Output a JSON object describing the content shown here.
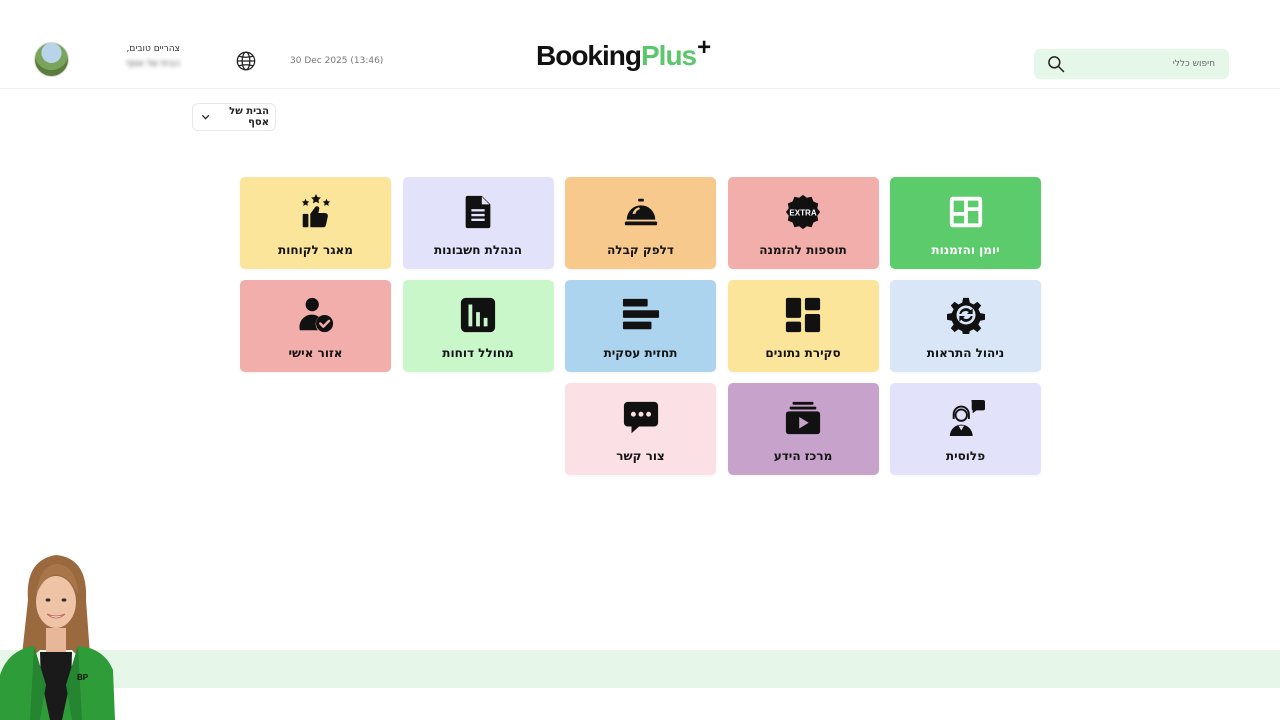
{
  "header": {
    "greeting": "צהריים טובים,",
    "business_name": "הבית של אסף",
    "datetime": "30 Dec 2025 (13:46)",
    "logo": {
      "part1": "Booking",
      "part2": "Plus",
      "plus": "+"
    },
    "search": {
      "placeholder": "חיפוש כללי"
    }
  },
  "business_selector": {
    "label": "הבית של אסף"
  },
  "tiles": [
    {
      "label": "יומן והזמנות",
      "icon": "calendar-grid-icon",
      "color": "#5ccb6c"
    },
    {
      "label": "תוספות להזמנה",
      "icon": "extra-badge-icon",
      "color": "#f2aeaa"
    },
    {
      "label": "דלפק קבלה",
      "icon": "service-bell-icon",
      "color": "#f7c98c"
    },
    {
      "label": "הנהלת חשבונות",
      "icon": "document-icon",
      "color": "#e3e2fb"
    },
    {
      "label": "מאגר לקוחות",
      "icon": "thumbs-up-stars-icon",
      "color": "#fbe59b"
    },
    {
      "label": "ניהול התראות",
      "icon": "gear-sync-icon",
      "color": "#d8e6f7"
    },
    {
      "label": "סקירת נתונים",
      "icon": "dashboard-tiles-icon",
      "color": "#fbe59b"
    },
    {
      "label": "תחזית עסקית",
      "icon": "bar-gantt-icon",
      "color": "#acd4ef"
    },
    {
      "label": "מחולל דוחות",
      "icon": "report-chart-icon",
      "color": "#c9f7ca"
    },
    {
      "label": "אזור אישי",
      "icon": "user-check-icon",
      "color": "#f2aeaa"
    },
    {
      "label": "פלוסית",
      "icon": "support-agent-icon",
      "color": "#e3e2fb"
    },
    {
      "label": "מרכז הידע",
      "icon": "video-library-icon",
      "color": "#c7a3cc"
    },
    {
      "label": "צור קשר",
      "icon": "chat-bubble-icon",
      "color": "#fbe1e6"
    }
  ],
  "presenter": {
    "badge": "BP"
  },
  "colors": {
    "accent": "#5cc66c",
    "search_bg": "#e5f7e8",
    "band": "#e6f7e9"
  }
}
